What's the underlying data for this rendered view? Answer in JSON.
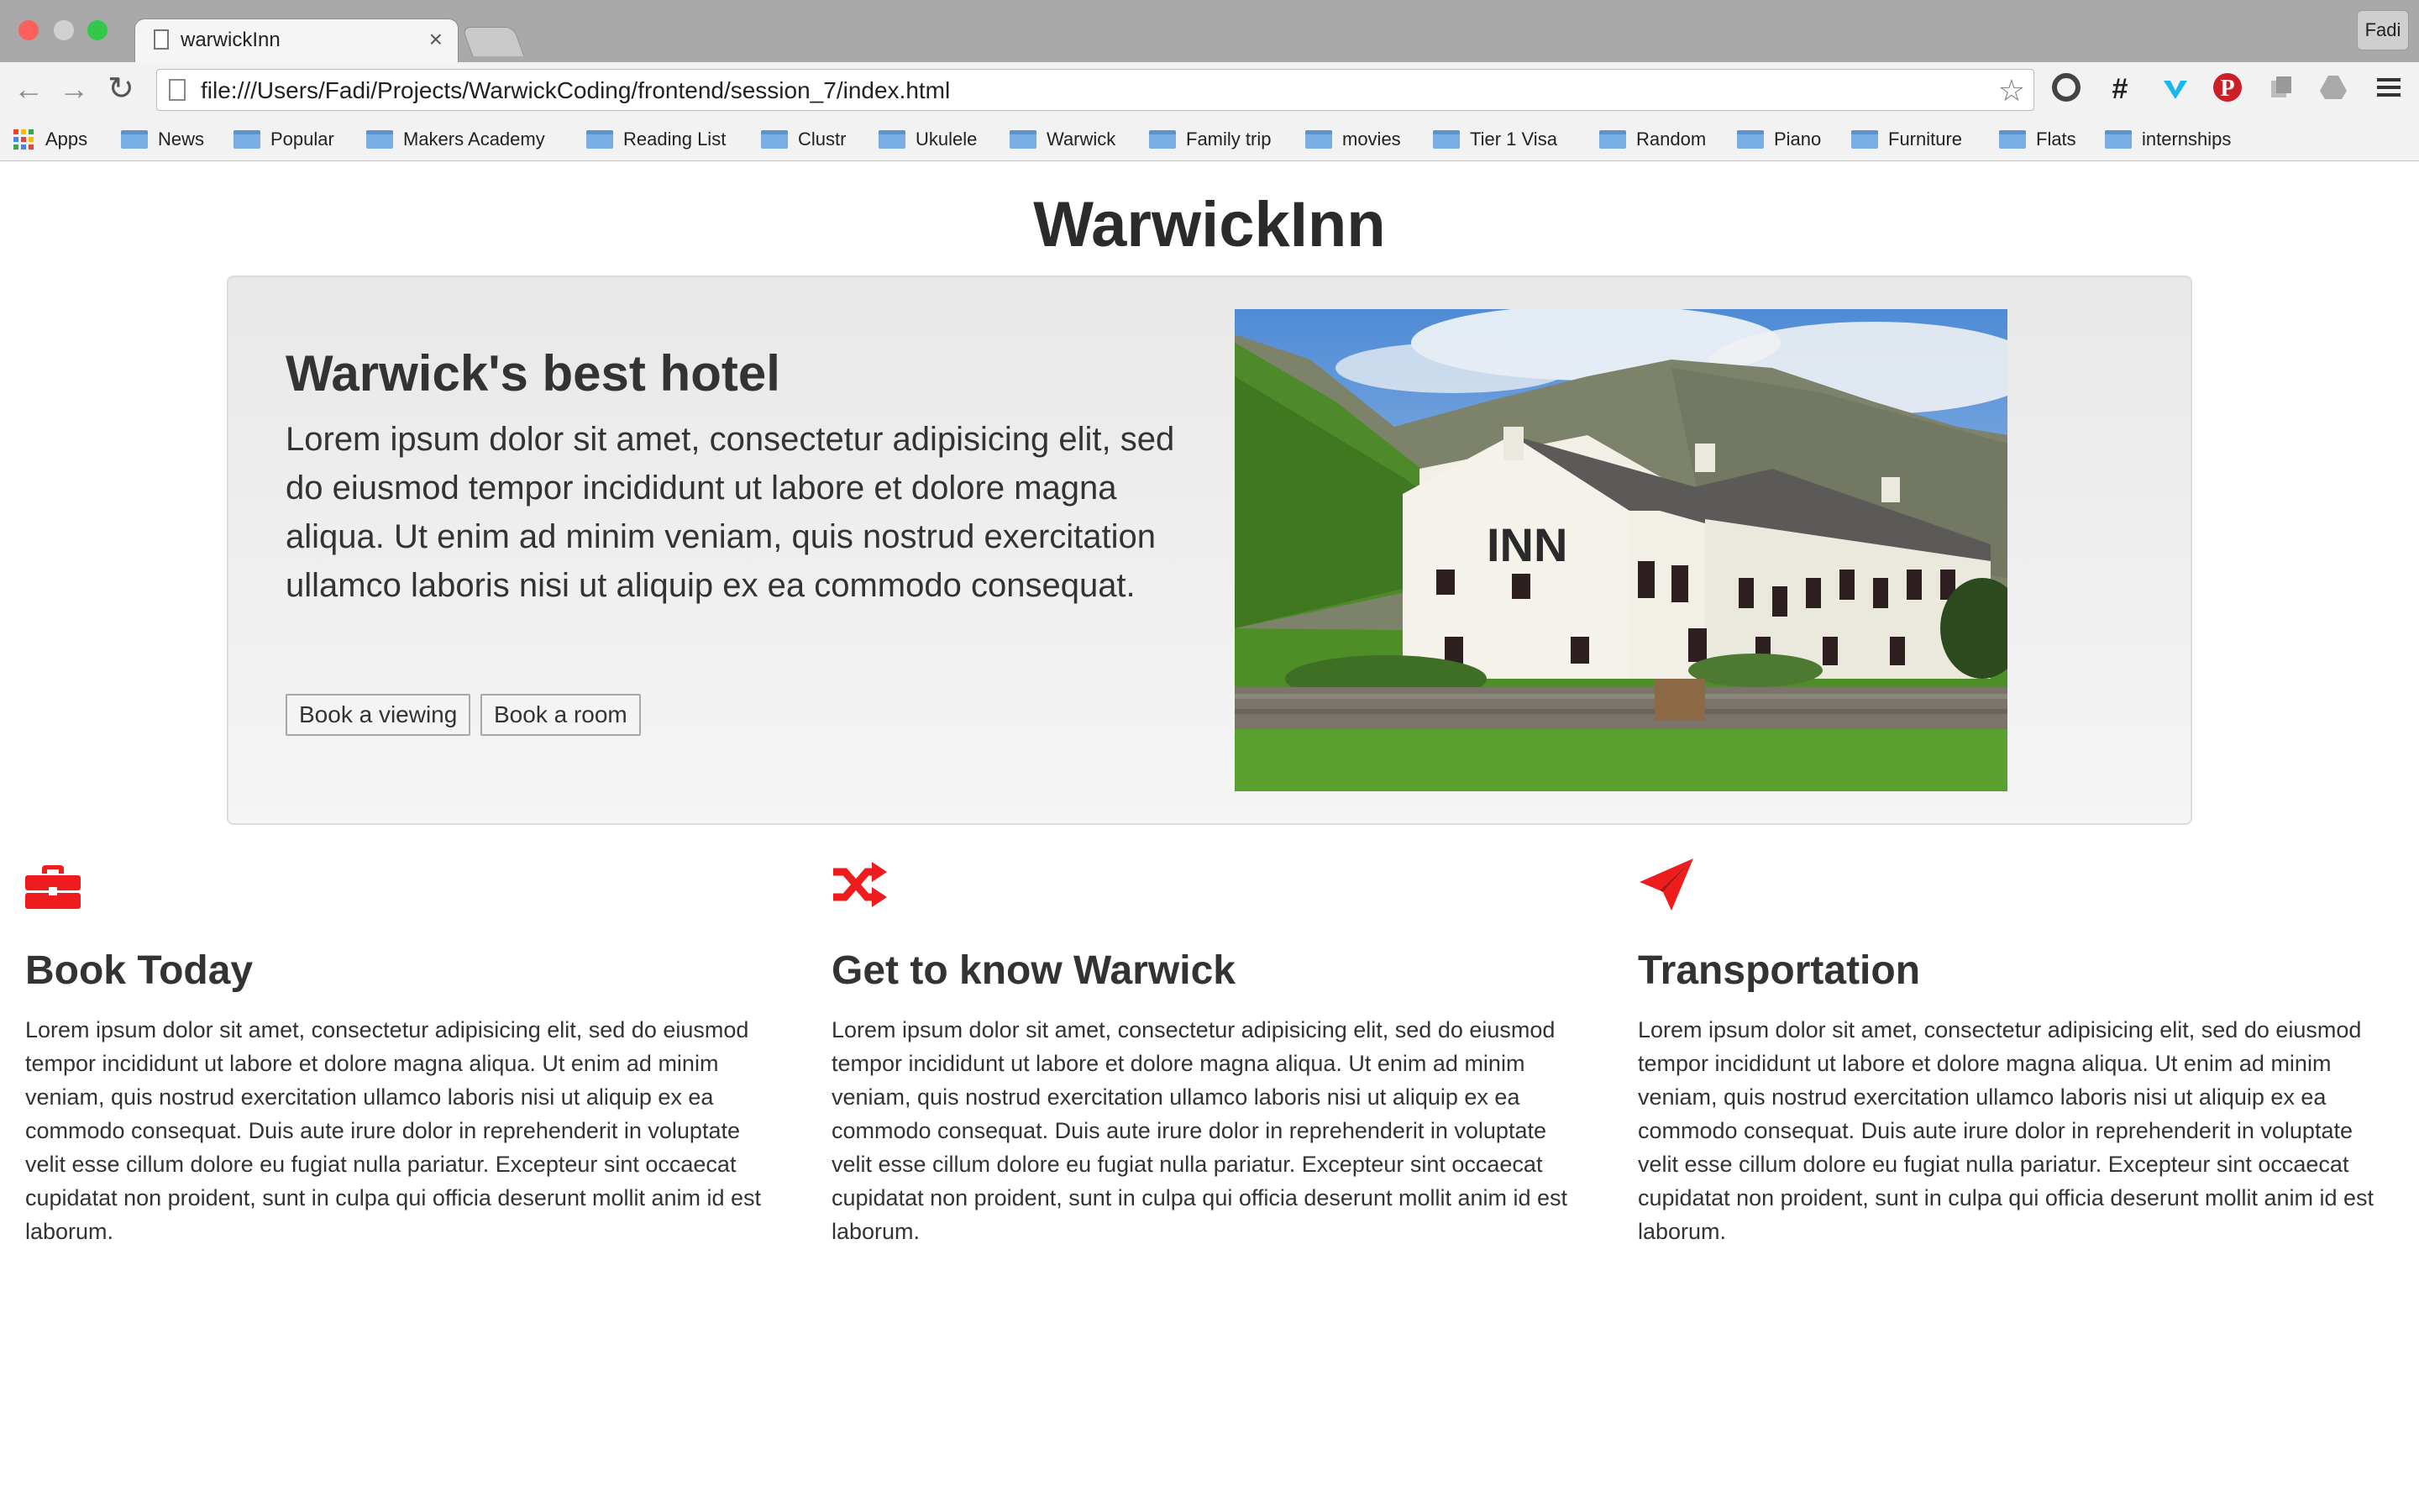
{
  "browser": {
    "tab_title": "warwickInn",
    "tab_close": "×",
    "url": "file:///Users/Fadi/Projects/WarwickCoding/frontend/session_7/index.html",
    "profile_name": "Fadi",
    "bookmarks": [
      {
        "label": "Apps",
        "icon": "apps-grid-icon"
      },
      {
        "label": "News",
        "icon": "folder-icon"
      },
      {
        "label": "Popular",
        "icon": "folder-icon"
      },
      {
        "label": "Makers Academy",
        "icon": "folder-icon"
      },
      {
        "label": "Reading List",
        "icon": "folder-icon"
      },
      {
        "label": "Clustr",
        "icon": "folder-icon"
      },
      {
        "label": "Ukulele",
        "icon": "folder-icon"
      },
      {
        "label": "Warwick",
        "icon": "folder-icon"
      },
      {
        "label": "Family trip",
        "icon": "folder-icon"
      },
      {
        "label": "movies",
        "icon": "folder-icon"
      },
      {
        "label": "Tier 1 Visa",
        "icon": "folder-icon"
      },
      {
        "label": "Random",
        "icon": "folder-icon"
      },
      {
        "label": "Piano",
        "icon": "folder-icon"
      },
      {
        "label": "Furniture",
        "icon": "folder-icon"
      },
      {
        "label": "Flats",
        "icon": "folder-icon"
      },
      {
        "label": "internships",
        "icon": "folder-icon"
      }
    ],
    "extensions": [
      "opera-icon",
      "hashtag-icon",
      "vimeo-icon",
      "pinterest-icon",
      "copy-icon",
      "drive-icon",
      "menu-icon"
    ]
  },
  "page": {
    "title": "WarwickInn",
    "hero": {
      "heading": "Warwick's best hotel",
      "text": "Lorem ipsum dolor sit amet, consectetur adipisicing elit, sed do eiusmod tempor incididunt ut labore et dolore magna aliqua. Ut enim ad minim veniam, quis nostrud exercitation ullamco laboris nisi ut aliquip ex ea commodo consequat.",
      "button_viewing": "Book a viewing",
      "button_room": "Book a room",
      "image_sign": "INN"
    },
    "features": [
      {
        "icon": "briefcase-icon",
        "heading": "Book Today",
        "text": "Lorem ipsum dolor sit amet, consectetur adipisicing elit, sed do eiusmod tempor incididunt ut labore et dolore magna aliqua. Ut enim ad minim veniam, quis nostrud exercitation ullamco laboris nisi ut aliquip ex ea commodo consequat. Duis aute irure dolor in reprehenderit in voluptate velit esse cillum dolore eu fugiat nulla pariatur. Excepteur sint occaecat cupidatat non proident, sunt in culpa qui officia deserunt mollit anim id est laborum."
      },
      {
        "icon": "shuffle-icon",
        "heading": "Get to know Warwick",
        "text": "Lorem ipsum dolor sit amet, consectetur adipisicing elit, sed do eiusmod tempor incididunt ut labore et dolore magna aliqua. Ut enim ad minim veniam, quis nostrud exercitation ullamco laboris nisi ut aliquip ex ea commodo consequat. Duis aute irure dolor in reprehenderit in voluptate velit esse cillum dolore eu fugiat nulla pariatur. Excepteur sint occaecat cupidatat non proident, sunt in culpa qui officia deserunt mollit anim id est laborum."
      },
      {
        "icon": "paper-plane-icon",
        "heading": "Transportation",
        "text": "Lorem ipsum dolor sit amet, consectetur adipisicing elit, sed do eiusmod tempor incididunt ut labore et dolore magna aliqua. Ut enim ad minim veniam, quis nostrud exercitation ullamco laboris nisi ut aliquip ex ea commodo consequat. Duis aute irure dolor in reprehenderit in voluptate velit esse cillum dolore eu fugiat nulla pariatur. Excepteur sint occaecat cupidatat non proident, sunt in culpa qui officia deserunt mollit anim id est laborum."
      }
    ]
  },
  "colors": {
    "accent": "#ee1c1c",
    "titlebar": "#a9a9a9",
    "toolbar": "#f2f2f2",
    "jumbotron": "#eeeeee",
    "text": "#333333"
  }
}
